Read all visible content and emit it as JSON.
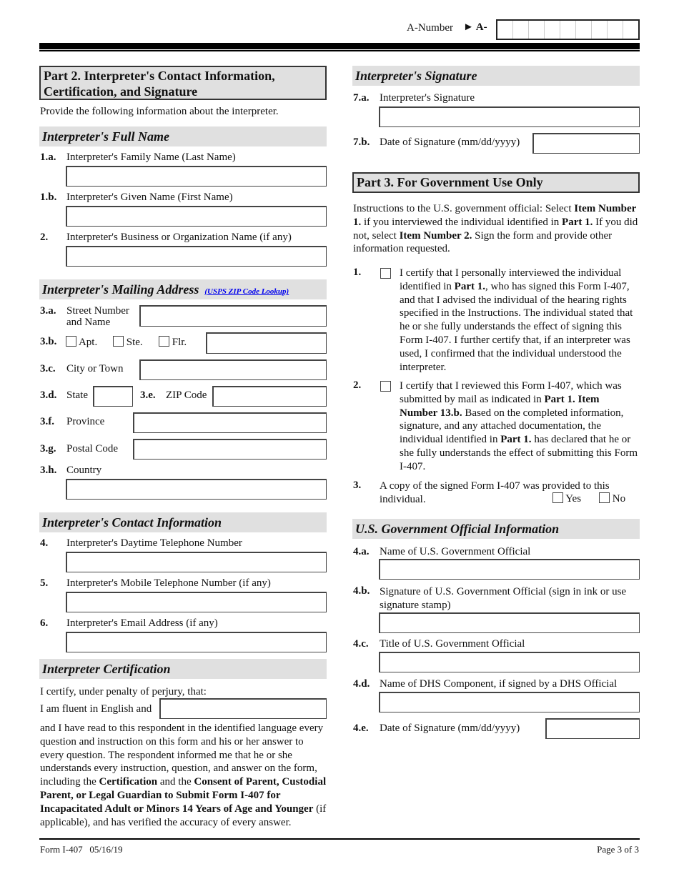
{
  "header": {
    "a_number_label": "A-Number",
    "a_number_prefix": "► A-",
    "a_number_cells": 9
  },
  "left": {
    "part2_title_line1": "Part 2.  Interpreter's Contact Information,",
    "part2_title_line2": "Certification, and Signature",
    "intro": "Provide the following information about the interpreter.",
    "full_name_header": "Interpreter's Full Name",
    "q1a_num": "1.a.",
    "q1a_label": "Interpreter's Family Name (Last Name)",
    "q1b_num": "1.b.",
    "q1b_label": "Interpreter's Given Name (First Name)",
    "q2_num": "2.",
    "q2_label": "Interpreter's Business or Organization Name (if any)",
    "mailing_header": "Interpreter's Mailing Address",
    "usps_link": "(USPS ZIP Code Lookup)",
    "q3a_num": "3.a.",
    "q3a_label_line1": "Street Number",
    "q3a_label_line2": "and Name",
    "q3b_num": "3.b.",
    "q3b_apt": "Apt.",
    "q3b_ste": "Ste.",
    "q3b_flr": "Flr.",
    "q3c_num": "3.c.",
    "q3c_label": "City or Town",
    "q3d_num": "3.d.",
    "q3d_label": "State",
    "q3e_num": "3.e.",
    "q3e_label": "ZIP Code",
    "q3f_num": "3.f.",
    "q3f_label": "Province",
    "q3g_num": "3.g.",
    "q3g_label": "Postal Code",
    "q3h_num": "3.h.",
    "q3h_label": "Country",
    "contact_header": "Interpreter's Contact Information",
    "q4_num": "4.",
    "q4_label": "Interpreter's Daytime Telephone Number",
    "q5_num": "5.",
    "q5_label": "Interpreter's Mobile Telephone Number (if any)",
    "q6_num": "6.",
    "q6_label": "Interpreter's Email Address (if any)",
    "cert_header": "Interpreter Certification",
    "cert_line1": "I certify, under penalty of perjury, that:",
    "cert_line2": "I am fluent in English and",
    "cert_para_1": "and I have read to this respondent in the identified language every question and instruction on this form and his or her answer to every question.  The respondent informed me that he or she understands every instruction, question, and answer on the form, including the ",
    "cert_para_b1": "Certification",
    "cert_para_2": " and the ",
    "cert_para_b2": "Consent of Parent, Custodial Parent, or Legal Guardian to Submit Form I-407 for Incapacitated Adult or Minors 14 Years of Age and Younger",
    "cert_para_3": " (if applicable), and has verified the accuracy of every answer."
  },
  "right": {
    "sig_header": "Interpreter's Signature",
    "q7a_num": "7.a.",
    "q7a_label": "Interpreter's Signature",
    "q7b_num": "7.b.",
    "q7b_label": "Date of Signature (mm/dd/yyyy)",
    "part3_title": "Part 3.  For Government Use Only",
    "instr_1": "Instructions to the U.S. government official:  Select ",
    "instr_b1": "Item Number 1.",
    "instr_2": " if you interviewed the individual identified in ",
    "instr_b2": "Part 1.",
    "instr_3": "  If you did not, select ",
    "instr_b3": "Item Number 2.",
    "instr_4": "  Sign the form and provide other information requested.",
    "g1_num": "1.",
    "g1_a": "I certify that I personally interviewed the individual identified in ",
    "g1_b": "Part 1.",
    "g1_c": ", who has signed this Form I-407, and that I advised the individual of the hearing rights specified in the Instructions.  The individual stated that he or she fully understands the effect of signing this Form I-407.  I further certify that, if an interpreter was used, I confirmed that the individual understood the interpreter.",
    "g2_num": "2.",
    "g2_a": "I certify that I reviewed this Form I-407, which was submitted by mail as indicated in ",
    "g2_b": "Part 1. Item Number 13.b.",
    "g2_c": "  Based on the completed information, signature, and any attached documentation, the individual identified in ",
    "g2_d": "Part 1.",
    "g2_e": " has declared that he or she fully understands the effect of submitting this Form I-407.",
    "g3_num": "3.",
    "g3_line1": "A copy of the signed Form I-407 was provided to this",
    "g3_line2": "individual.",
    "g3_yes": "Yes",
    "g3_no": "No",
    "official_header": "U.S. Government Official Information",
    "q4a_num": "4.a.",
    "q4a_label": "Name of U.S. Government Official",
    "q4b_num": "4.b.",
    "q4b_label": "Signature of U.S. Government Official (sign in ink or use signature stamp)",
    "q4c_num": "4.c.",
    "q4c_label": "Title of U.S. Government Official",
    "q4d_num": "4.d.",
    "q4d_label": "Name of DHS Component, if signed by a DHS Official",
    "q4e_num": "4.e.",
    "q4e_label": "Date of Signature (mm/dd/yyyy)"
  },
  "footer": {
    "form_id": "Form I-407   05/16/19",
    "page": "Page 3 of 3"
  }
}
